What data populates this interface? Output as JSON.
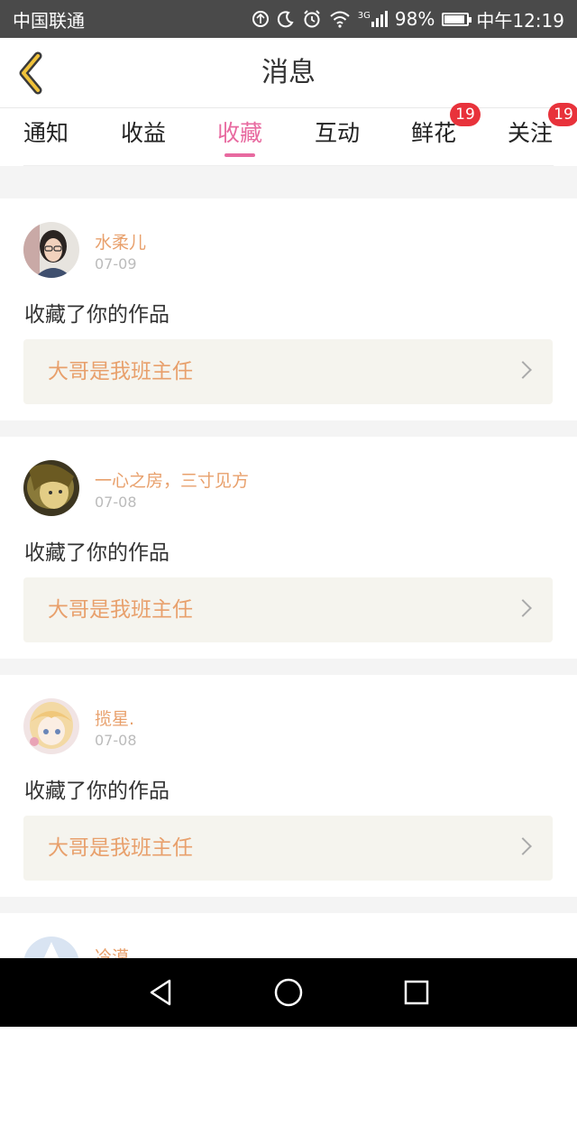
{
  "status_bar": {
    "carrier": "中国联通",
    "network": "3G",
    "battery": "98%",
    "time": "中午12:19",
    "icons": [
      "data-saver-icon",
      "moon-icon",
      "alarm-icon",
      "wifi-icon",
      "signal-icon",
      "battery-icon"
    ]
  },
  "header": {
    "title": "消息",
    "back_icon": "chevron-left-icon"
  },
  "tabs": [
    {
      "label": "通知",
      "active": false,
      "badge": ""
    },
    {
      "label": "收益",
      "active": false,
      "badge": ""
    },
    {
      "label": "收藏",
      "active": true,
      "badge": ""
    },
    {
      "label": "互动",
      "active": false,
      "badge": ""
    },
    {
      "label": "鲜花",
      "active": false,
      "badge": "19"
    },
    {
      "label": "关注",
      "active": false,
      "badge": "19"
    }
  ],
  "feed": [
    {
      "user": "水柔儿",
      "date": "07-09",
      "action": "收藏了你的作品",
      "work": "大哥是我班主任"
    },
    {
      "user": "一心之房，三寸见方",
      "date": "07-08",
      "action": "收藏了你的作品",
      "work": "大哥是我班主任"
    },
    {
      "user": "揽星.",
      "date": "07-08",
      "action": "收藏了你的作品",
      "work": "大哥是我班主任"
    },
    {
      "user": "冷漠",
      "date": "",
      "action": "",
      "work": ""
    }
  ],
  "colors": {
    "accent": "#e86aa0",
    "name": "#e8a06c",
    "badge": "#e8323b",
    "link_bg": "#f5f4ee"
  },
  "nav": [
    "back-triangle-icon",
    "home-circle-icon",
    "recents-square-icon"
  ]
}
